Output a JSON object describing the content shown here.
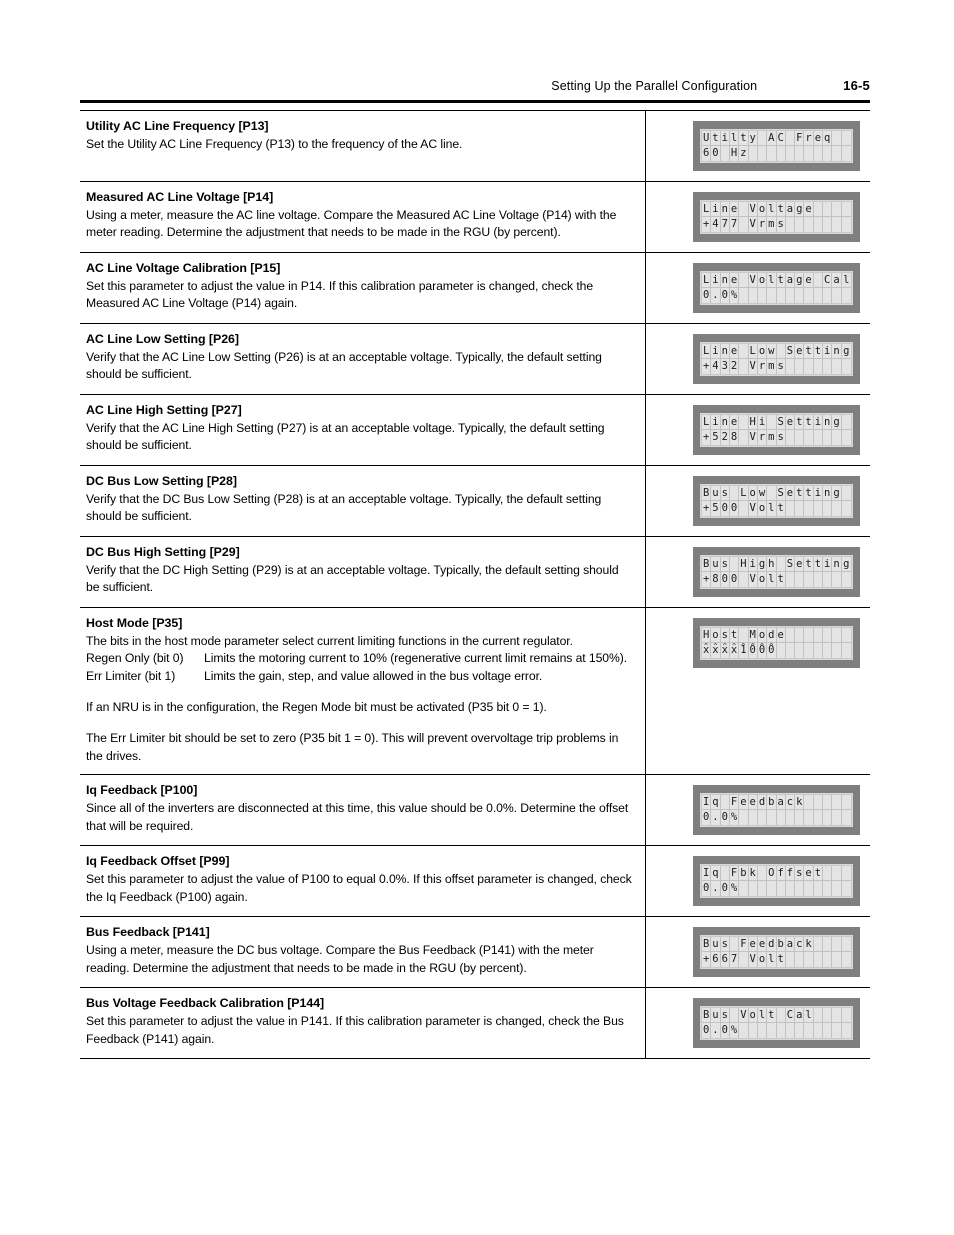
{
  "header": {
    "title": "Setting Up the Parallel Configuration",
    "page_number": "16-5"
  },
  "rows": [
    {
      "title": "Utility AC Line Frequency [P13]",
      "paragraphs": [
        "Set the Utility AC Line Frequency (P13) to the frequency of the AC line."
      ],
      "display": {
        "line1": "Utilty AC Freq",
        "line2": "60 Hz"
      }
    },
    {
      "title": "Measured AC Line Voltage [P14]",
      "paragraphs": [
        "Using a meter, measure the AC line voltage.  Compare the Measured AC Line Voltage (P14) with the meter reading.  Determine the adjustment that needs to be made in the RGU (by percent)."
      ],
      "display": {
        "line1": "Line Voltage",
        "line2": "+477 Vrms"
      }
    },
    {
      "title": "AC Line Voltage Calibration [P15]",
      "paragraphs": [
        "Set this parameter to adjust the value in P14.  If this calibration parameter is changed, check the Measured AC Line Voltage (P14) again."
      ],
      "display": {
        "line1": "Line Voltage Cal",
        "line2": "0.0%"
      }
    },
    {
      "title": "AC Line Low Setting [P26]",
      "paragraphs": [
        "Verify that the AC Line Low Setting (P26) is at an acceptable voltage.  Typically, the default setting should be sufficient."
      ],
      "display": {
        "line1": "Line Low Setting",
        "line2": "+432 Vrms"
      }
    },
    {
      "title": "AC Line High Setting [P27]",
      "paragraphs": [
        "Verify that the AC Line High Setting (P27) is at an acceptable voltage.  Typically, the default setting should be sufficient."
      ],
      "display": {
        "line1": "Line Hi Setting",
        "line2": "+528 Vrms"
      }
    },
    {
      "title": "DC Bus Low Setting [P28]",
      "paragraphs": [
        "Verify that the DC Bus Low Setting (P28) is at an acceptable voltage.  Typically, the default setting should be sufficient."
      ],
      "display": {
        "line1": "Bus Low Setting",
        "line2": "+500 Volt"
      }
    },
    {
      "title": "DC Bus High Setting [P29]",
      "paragraphs": [
        "Verify that the DC High Setting (P29) is at an acceptable voltage.  Typically, the default setting should be sufficient."
      ],
      "display": {
        "line1": "Bus High Setting",
        "line2": "+800 Volt"
      }
    },
    {
      "title": "Host Mode [P35]",
      "intro": "The bits in the host mode parameter select current limiting functions in the current regulator.",
      "bits": [
        {
          "label": "Regen Only (bit 0)",
          "description": "Limits the motoring current to 10% (regenerative current limit remains at 150%)."
        },
        {
          "label": "Err Limiter (bit 1)",
          "description": "Limits the gain, step, and value allowed in the bus voltage error."
        }
      ],
      "paragraphs": [
        "If an NRU is in the configuration, the Regen Mode bit must be activated (P35 bit 0 = 1).",
        "The Err Limiter bit should be set to zero (P35 bit 1 = 0).  This will prevent overvoltage trip problems in the drives."
      ],
      "display": {
        "line1": "Host Mode",
        "line2": "xxxx1000",
        "line2_superscript": "xxxxxxxx"
      }
    },
    {
      "title": "Iq Feedback [P100]",
      "paragraphs": [
        "Since all of the inverters are disconnected at this time, this value should be 0.0%.  Determine the offset that will be required."
      ],
      "display": {
        "line1": "Iq Feedback",
        "line2": "0.0%"
      }
    },
    {
      "title": "Iq Feedback Offset [P99]",
      "paragraphs": [
        "Set this parameter to adjust the value of P100 to equal 0.0%.  If this offset parameter is changed, check the Iq Feedback (P100) again."
      ],
      "display": {
        "line1": "Iq Fbk Offset",
        "line2": "0.0%"
      }
    },
    {
      "title": "Bus Feedback [P141]",
      "paragraphs": [
        "Using a meter, measure the DC bus voltage.  Compare the Bus Feedback (P141) with the meter reading.  Determine the adjustment that needs to be made in the RGU (by percent)."
      ],
      "display": {
        "line1": "Bus Feedback",
        "line2": "+667 Volt"
      }
    },
    {
      "title": "Bus Voltage Feedback Calibration [P144]",
      "paragraphs": [
        "Set this parameter to adjust the value in P141.  If this calibration parameter is changed, check the Bus Feedback (P141) again."
      ],
      "display": {
        "line1": "Bus Volt Cal",
        "line2": "0.0%"
      }
    }
  ],
  "colors": {
    "lcd_bezel": "#7f7f7f",
    "lcd_cell": "#e4e4e4",
    "lcd_text": "#1c1c1c",
    "rule": "#000000"
  },
  "lcd_columns": 16
}
